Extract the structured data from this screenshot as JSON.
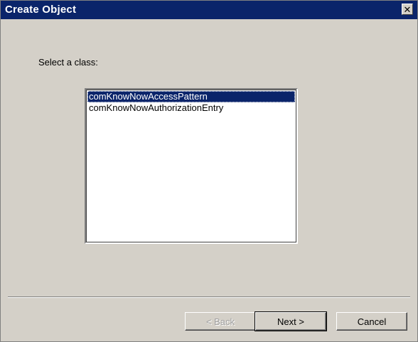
{
  "window": {
    "title": "Create Object",
    "close_glyph": "✕"
  },
  "prompt": {
    "text": "Select a class:"
  },
  "classes": [
    "comKnowNowAccessPattern",
    "comKnowNowAuthorizationEntry"
  ],
  "selected_index": 0,
  "buttons": {
    "back": "< Back",
    "next": "Next >",
    "cancel": "Cancel"
  },
  "colors": {
    "titlebar": "#0a246a",
    "selection": "#0a246a",
    "face": "#d4d0c8"
  }
}
